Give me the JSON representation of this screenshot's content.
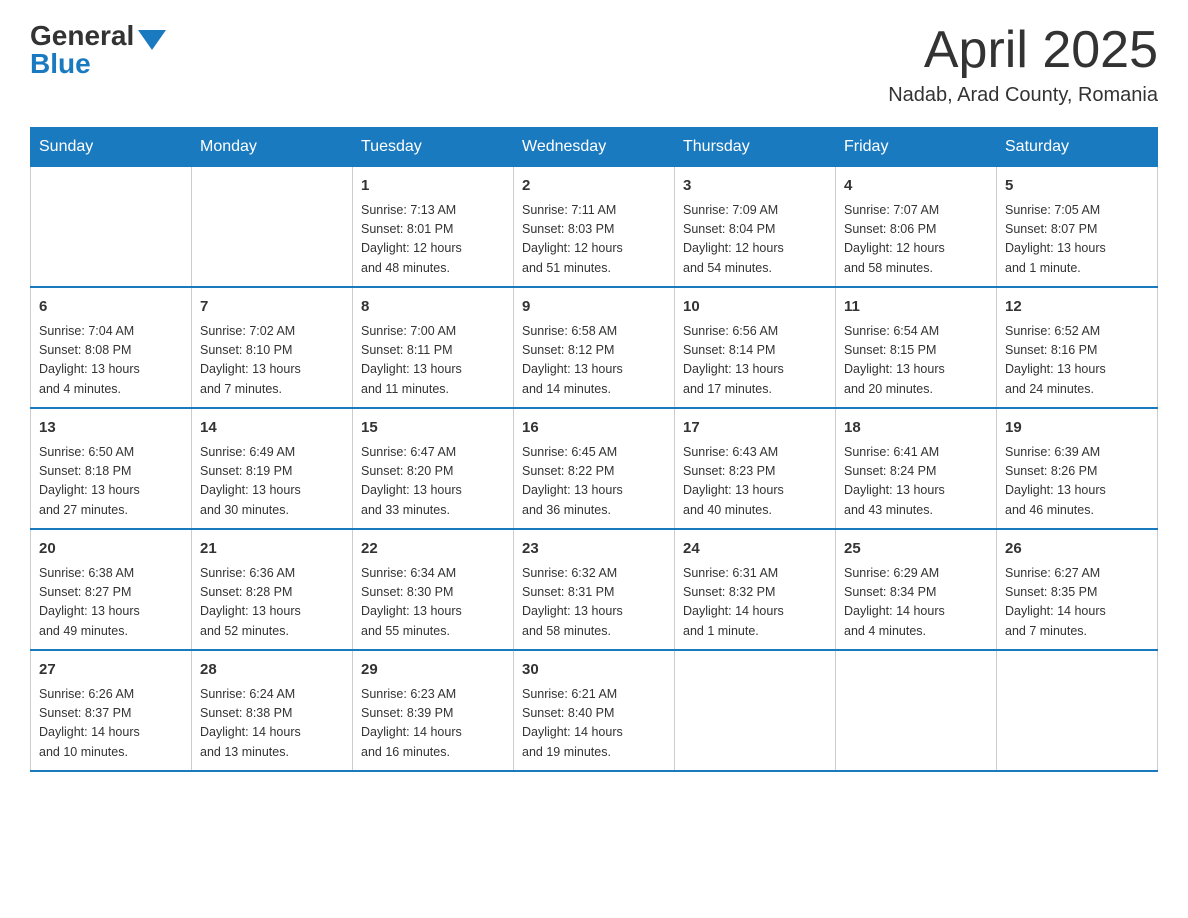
{
  "header": {
    "logo_general": "General",
    "logo_blue": "Blue",
    "month_title": "April 2025",
    "location": "Nadab, Arad County, Romania"
  },
  "calendar": {
    "days_of_week": [
      "Sunday",
      "Monday",
      "Tuesday",
      "Wednesday",
      "Thursday",
      "Friday",
      "Saturday"
    ],
    "weeks": [
      [
        {
          "day": "",
          "info": ""
        },
        {
          "day": "",
          "info": ""
        },
        {
          "day": "1",
          "info": "Sunrise: 7:13 AM\nSunset: 8:01 PM\nDaylight: 12 hours\nand 48 minutes."
        },
        {
          "day": "2",
          "info": "Sunrise: 7:11 AM\nSunset: 8:03 PM\nDaylight: 12 hours\nand 51 minutes."
        },
        {
          "day": "3",
          "info": "Sunrise: 7:09 AM\nSunset: 8:04 PM\nDaylight: 12 hours\nand 54 minutes."
        },
        {
          "day": "4",
          "info": "Sunrise: 7:07 AM\nSunset: 8:06 PM\nDaylight: 12 hours\nand 58 minutes."
        },
        {
          "day": "5",
          "info": "Sunrise: 7:05 AM\nSunset: 8:07 PM\nDaylight: 13 hours\nand 1 minute."
        }
      ],
      [
        {
          "day": "6",
          "info": "Sunrise: 7:04 AM\nSunset: 8:08 PM\nDaylight: 13 hours\nand 4 minutes."
        },
        {
          "day": "7",
          "info": "Sunrise: 7:02 AM\nSunset: 8:10 PM\nDaylight: 13 hours\nand 7 minutes."
        },
        {
          "day": "8",
          "info": "Sunrise: 7:00 AM\nSunset: 8:11 PM\nDaylight: 13 hours\nand 11 minutes."
        },
        {
          "day": "9",
          "info": "Sunrise: 6:58 AM\nSunset: 8:12 PM\nDaylight: 13 hours\nand 14 minutes."
        },
        {
          "day": "10",
          "info": "Sunrise: 6:56 AM\nSunset: 8:14 PM\nDaylight: 13 hours\nand 17 minutes."
        },
        {
          "day": "11",
          "info": "Sunrise: 6:54 AM\nSunset: 8:15 PM\nDaylight: 13 hours\nand 20 minutes."
        },
        {
          "day": "12",
          "info": "Sunrise: 6:52 AM\nSunset: 8:16 PM\nDaylight: 13 hours\nand 24 minutes."
        }
      ],
      [
        {
          "day": "13",
          "info": "Sunrise: 6:50 AM\nSunset: 8:18 PM\nDaylight: 13 hours\nand 27 minutes."
        },
        {
          "day": "14",
          "info": "Sunrise: 6:49 AM\nSunset: 8:19 PM\nDaylight: 13 hours\nand 30 minutes."
        },
        {
          "day": "15",
          "info": "Sunrise: 6:47 AM\nSunset: 8:20 PM\nDaylight: 13 hours\nand 33 minutes."
        },
        {
          "day": "16",
          "info": "Sunrise: 6:45 AM\nSunset: 8:22 PM\nDaylight: 13 hours\nand 36 minutes."
        },
        {
          "day": "17",
          "info": "Sunrise: 6:43 AM\nSunset: 8:23 PM\nDaylight: 13 hours\nand 40 minutes."
        },
        {
          "day": "18",
          "info": "Sunrise: 6:41 AM\nSunset: 8:24 PM\nDaylight: 13 hours\nand 43 minutes."
        },
        {
          "day": "19",
          "info": "Sunrise: 6:39 AM\nSunset: 8:26 PM\nDaylight: 13 hours\nand 46 minutes."
        }
      ],
      [
        {
          "day": "20",
          "info": "Sunrise: 6:38 AM\nSunset: 8:27 PM\nDaylight: 13 hours\nand 49 minutes."
        },
        {
          "day": "21",
          "info": "Sunrise: 6:36 AM\nSunset: 8:28 PM\nDaylight: 13 hours\nand 52 minutes."
        },
        {
          "day": "22",
          "info": "Sunrise: 6:34 AM\nSunset: 8:30 PM\nDaylight: 13 hours\nand 55 minutes."
        },
        {
          "day": "23",
          "info": "Sunrise: 6:32 AM\nSunset: 8:31 PM\nDaylight: 13 hours\nand 58 minutes."
        },
        {
          "day": "24",
          "info": "Sunrise: 6:31 AM\nSunset: 8:32 PM\nDaylight: 14 hours\nand 1 minute."
        },
        {
          "day": "25",
          "info": "Sunrise: 6:29 AM\nSunset: 8:34 PM\nDaylight: 14 hours\nand 4 minutes."
        },
        {
          "day": "26",
          "info": "Sunrise: 6:27 AM\nSunset: 8:35 PM\nDaylight: 14 hours\nand 7 minutes."
        }
      ],
      [
        {
          "day": "27",
          "info": "Sunrise: 6:26 AM\nSunset: 8:37 PM\nDaylight: 14 hours\nand 10 minutes."
        },
        {
          "day": "28",
          "info": "Sunrise: 6:24 AM\nSunset: 8:38 PM\nDaylight: 14 hours\nand 13 minutes."
        },
        {
          "day": "29",
          "info": "Sunrise: 6:23 AM\nSunset: 8:39 PM\nDaylight: 14 hours\nand 16 minutes."
        },
        {
          "day": "30",
          "info": "Sunrise: 6:21 AM\nSunset: 8:40 PM\nDaylight: 14 hours\nand 19 minutes."
        },
        {
          "day": "",
          "info": ""
        },
        {
          "day": "",
          "info": ""
        },
        {
          "day": "",
          "info": ""
        }
      ]
    ]
  }
}
